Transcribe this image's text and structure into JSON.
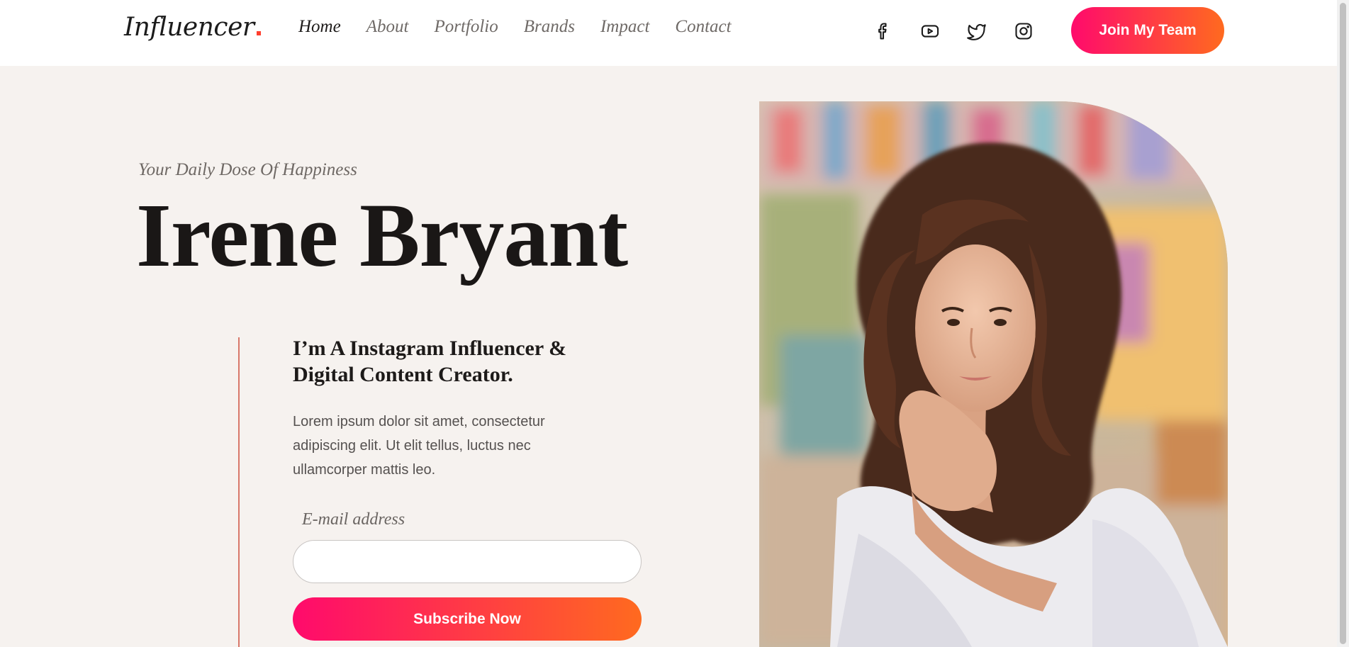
{
  "header": {
    "logo": "Influencer",
    "nav": [
      {
        "label": "Home"
      },
      {
        "label": "About"
      },
      {
        "label": "Portfolio"
      },
      {
        "label": "Brands"
      },
      {
        "label": "Impact"
      },
      {
        "label": "Contact"
      }
    ],
    "socials": [
      "facebook-icon",
      "youtube-icon",
      "twitter-icon",
      "instagram-icon"
    ],
    "cta_label": "Join My Team"
  },
  "hero": {
    "tagline": "Your Daily Dose Of Happiness",
    "name": "Irene Bryant",
    "intro_title": "I’m A Instagram Influencer & Digital Content Creator.",
    "intro_body": "Lorem ipsum dolor sit amet, consectetur adipiscing elit. Ut elit tellus, luctus nec ullamcorper mattis leo.",
    "email_label": "E-mail address",
    "email_value": "",
    "subscribe_label": "Subscribe Now"
  },
  "colors": {
    "brand_gradient_start": "#ff0a6c",
    "brand_gradient_end": "#ff6a1f",
    "accent_line": "#d8786a",
    "page_background": "#f6f2ef"
  }
}
